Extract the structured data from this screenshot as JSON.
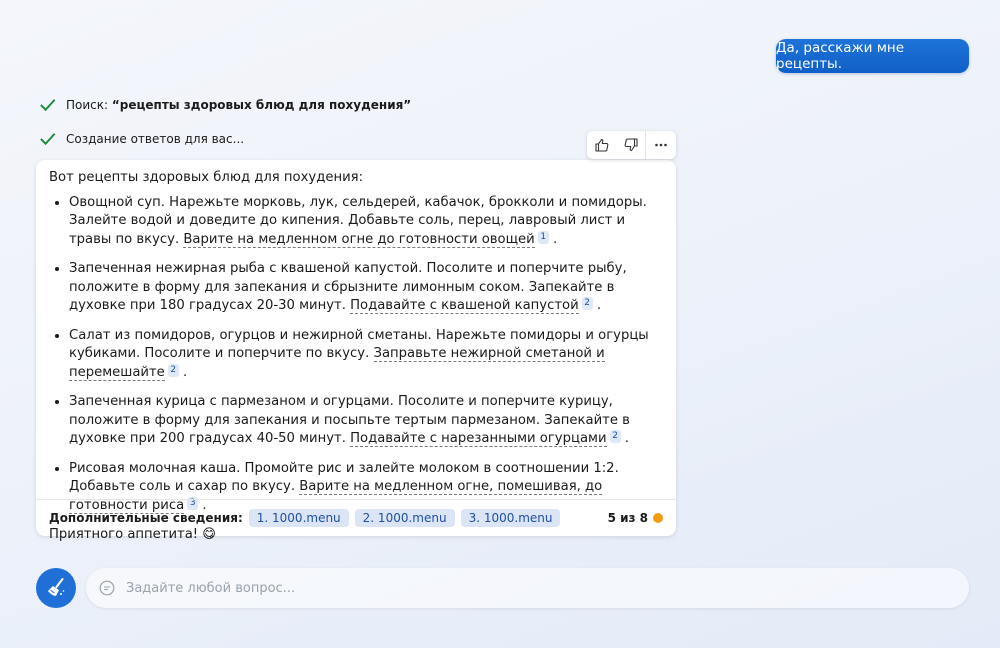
{
  "user_message": "Да, расскажи мне рецепты.",
  "status": {
    "search_prefix": "Поиск: ",
    "search_query": "“рецепты здоровых блюд для похудения”",
    "generating": "Создание ответов для вас..."
  },
  "answer": {
    "intro": "Вот рецепты здоровых блюд для похудения:",
    "items": [
      {
        "text": "Овощной суп. Нарежьте морковь, лук, сельдерей, кабачок, брокколи и помидоры. Залейте водой и доведите до кипения. Добавьте соль, перец, лавровый лист и травы по вкусу. ",
        "link": "Варите на медленном огне до готовности овощей",
        "cite": "1",
        "end": "."
      },
      {
        "text": "Запеченная нежирная рыба с квашеной капустой. Посолите и поперчите рыбу, положите в форму для запекания и сбрызните лимонным соком. Запекайте в духовке при 180 градусах 20-30 минут. ",
        "link": "Подавайте с квашеной капустой",
        "cite": "2",
        "end": "."
      },
      {
        "text": "Салат из помидоров, огурцов и нежирной сметаны. Нарежьте помидоры и огурцы кубиками. Посолите и поперчите по вкусу. ",
        "link": "Заправьте нежирной сметаной и перемешайте",
        "cite": "2",
        "end": "."
      },
      {
        "text": "Запеченная курица с пармезаном и огурцами. Посолите и поперчите курицу, положите в форму для запекания и посыпьте тертым пармезаном. Запекайте в духовке при 200 градусах 40-50 минут. ",
        "link": "Подавайте с нарезанными огурцами",
        "cite": "2",
        "end": "."
      },
      {
        "text": "Рисовая молочная каша. Промойте рис и залейте молоком в соотношении 1:2. Добавьте соль и сахар по вкусу. ",
        "link": "Варите на медленном огне, помешивая, до готовности риса",
        "cite": "3",
        "end": "."
      }
    ],
    "outro": "Приятного аппетита! 😋"
  },
  "footer": {
    "label": "Дополнительные сведения:",
    "sources": [
      "1. 1000.menu",
      "2. 1000.menu",
      "3. 1000.menu"
    ],
    "counter": "5 из 8"
  },
  "input": {
    "placeholder": "Задайте любой вопрос..."
  },
  "colors": {
    "accent": "#1f6fd6",
    "check": "#1a8a3a",
    "counter_dot": "#f39c12"
  }
}
